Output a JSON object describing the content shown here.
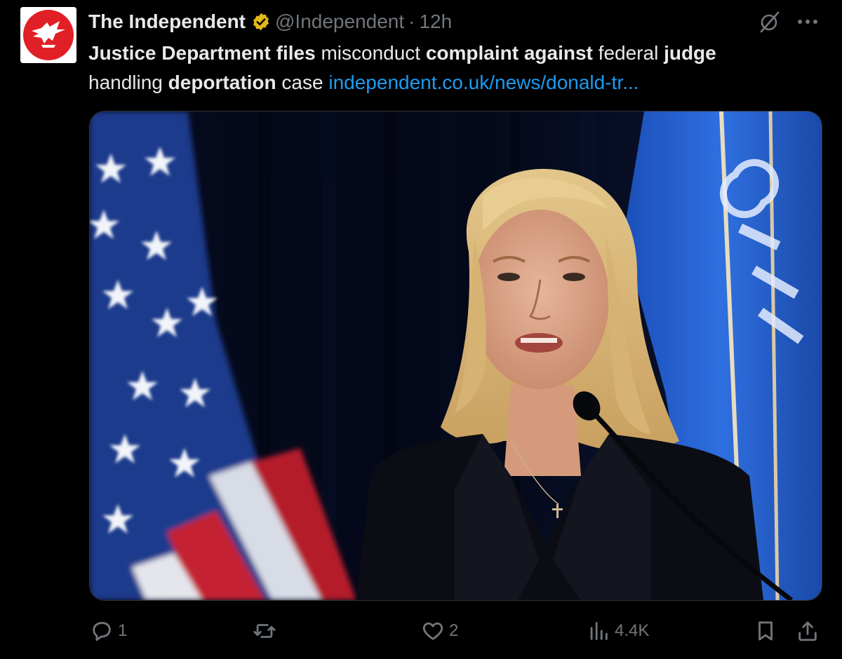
{
  "tweet": {
    "author": {
      "display_name": "The Independent",
      "handle": "@Independent",
      "separator": "·",
      "time": "12h",
      "verified": true,
      "avatar_icon": "independent-eagle-logo",
      "avatar_color": "#e11f26"
    },
    "text": {
      "seg1_bold": "Justice Department files",
      "seg2": " misconduct ",
      "seg3_bold": "complaint against",
      "seg4": " federal ",
      "seg5_bold": "judge",
      "seg6": " handling ",
      "seg7_bold": "deportation",
      "seg8": " case ",
      "link": "independent.co.uk/news/donald-tr..."
    },
    "media": {
      "type": "photo",
      "subject": "woman speaking at podium microphone",
      "background": "US flag and blue Department of Justice flag"
    },
    "header_icons": [
      "grok-icon",
      "more-icon"
    ],
    "actions": {
      "reply_count": "1",
      "retweet_count": "",
      "like_count": "2",
      "views_count": "4.4K"
    },
    "colors": {
      "background": "#000000",
      "text": "#e7e9ea",
      "muted": "#71767b",
      "link": "#1d9bf0",
      "verified_badge": "#e2b719"
    }
  }
}
